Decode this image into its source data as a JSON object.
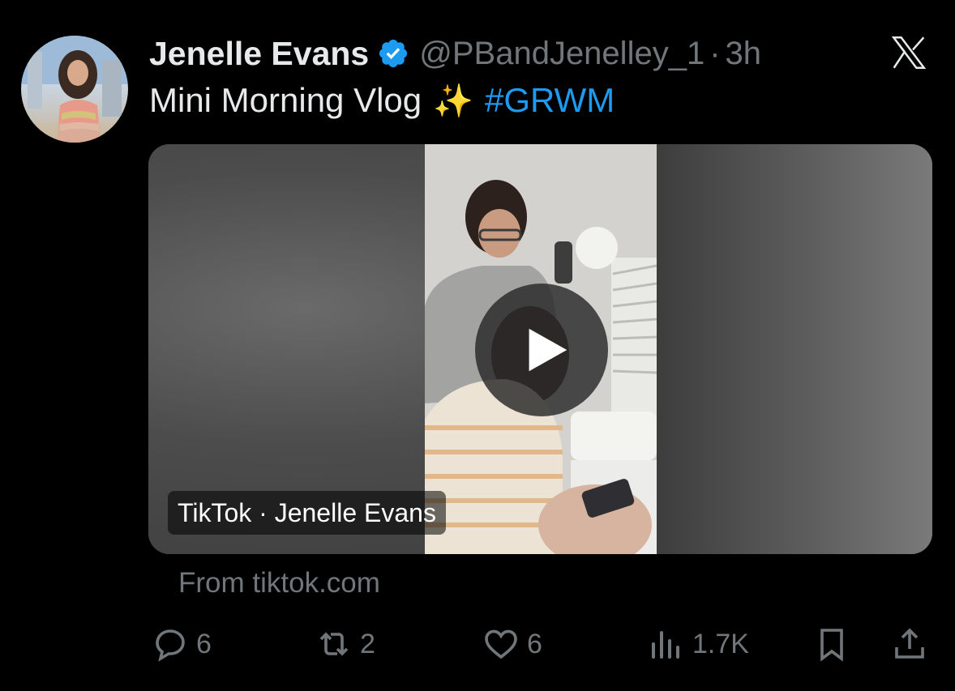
{
  "tweet": {
    "author_name": "Jenelle Evans",
    "handle": "@PBandJenelley_1",
    "separator": "·",
    "time": "3h",
    "text": "Mini Morning Vlog",
    "sparkle_emoji": "✨",
    "hashtag": "#GRWM",
    "verified_icon": "verified-badge-icon",
    "brand_icon": "x-logo-icon"
  },
  "media": {
    "source_label": "TikTok · Jenelle Evans",
    "from_text": "From tiktok.com",
    "play_icon": "play-icon"
  },
  "actions": {
    "replies": "6",
    "reposts": "2",
    "likes": "6",
    "views": "1.7K"
  },
  "colors": {
    "background": "#000000",
    "text_primary": "#e7e9ea",
    "text_secondary": "#71767b",
    "accent": "#1d9bf0"
  }
}
